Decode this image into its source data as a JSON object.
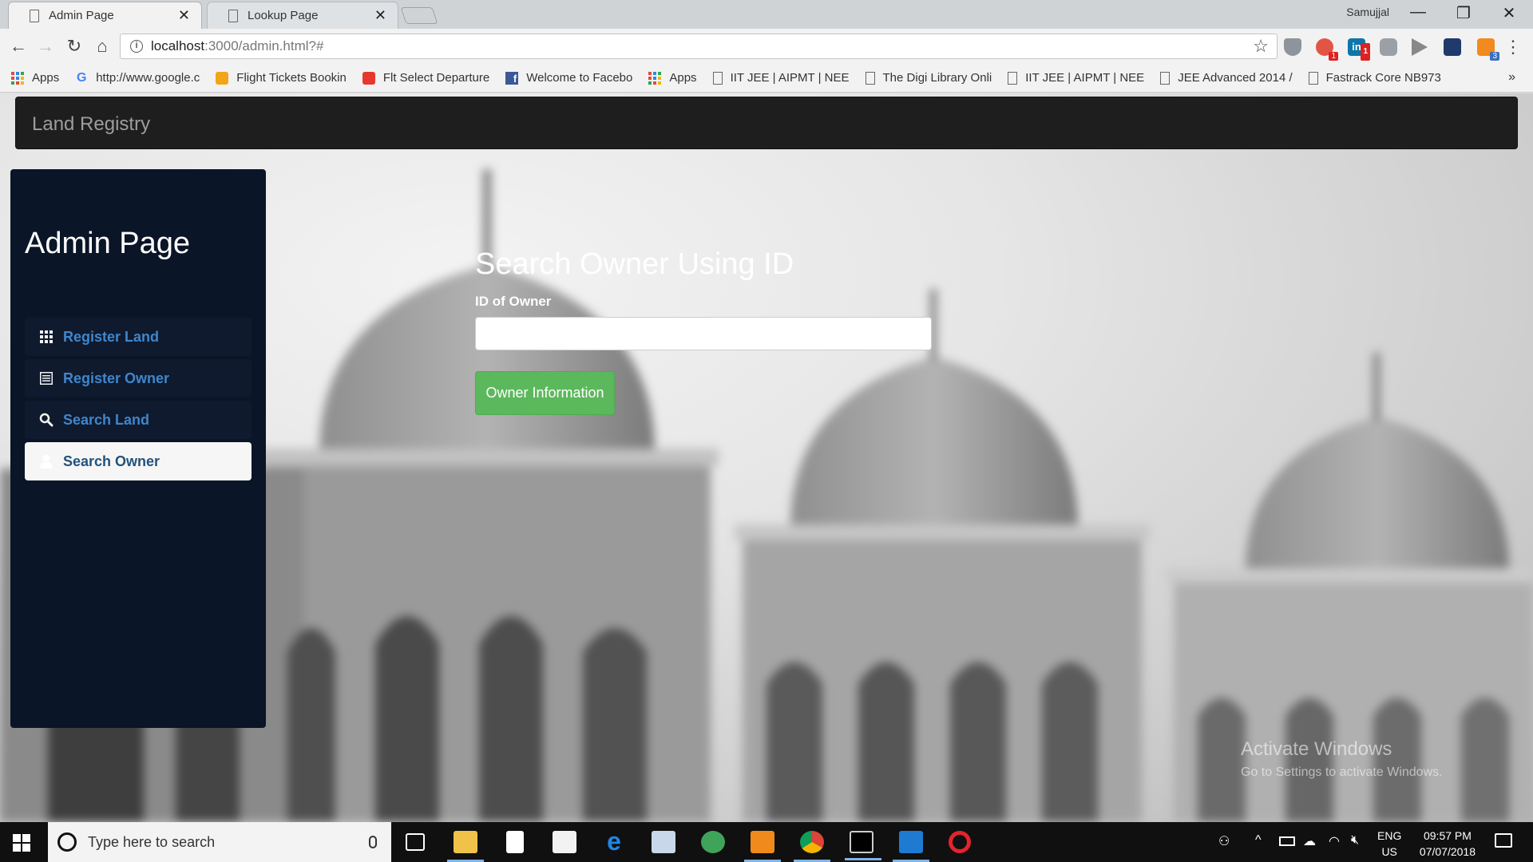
{
  "browser": {
    "tabs": [
      {
        "title": "Admin Page",
        "close": "✕"
      },
      {
        "title": "Lookup Page",
        "close": "✕"
      }
    ],
    "profile": "Samujjal",
    "window_controls": {
      "minimize": "—",
      "restore": "❐",
      "close": "✕"
    },
    "nav": {
      "back": "←",
      "forward": "→",
      "reload": "↻",
      "home": "⌂"
    },
    "url_host": "localhost",
    "url_rest": ":3000/admin.html?#",
    "star": "☆",
    "menu": "⋮",
    "extension_badges": {
      "ext1": "1",
      "ext2": "1",
      "ext3": "3"
    },
    "bookmarks": [
      {
        "icon": "apps-icon",
        "label": "Apps"
      },
      {
        "icon": "google-icon",
        "label": "http://www.google.c"
      },
      {
        "icon": "flight-icon",
        "label": "Flight Tickets Bookin"
      },
      {
        "icon": "makemytrip-icon",
        "label": "Flt Select Departure"
      },
      {
        "icon": "facebook-icon",
        "label": "Welcome to Facebo"
      },
      {
        "icon": "apps-icon",
        "label": "Apps"
      },
      {
        "icon": "page-icon",
        "label": "IIT JEE | AIPMT | NEE"
      },
      {
        "icon": "page-icon",
        "label": "The Digi Library Onli"
      },
      {
        "icon": "page-icon",
        "label": "IIT JEE | AIPMT | NEE"
      },
      {
        "icon": "page-icon",
        "label": "JEE Advanced 2014 /"
      },
      {
        "icon": "page-icon",
        "label": "Fastrack Core NB973"
      }
    ],
    "bookmarks_more": "»"
  },
  "page": {
    "brand": "Land Registry",
    "sidebar": {
      "title": "Admin Page",
      "items": [
        {
          "label": "Register Land",
          "icon": "grid-icon",
          "active": false
        },
        {
          "label": "Register Owner",
          "icon": "list-icon",
          "active": false
        },
        {
          "label": "Search Land",
          "icon": "search-icon",
          "active": false
        },
        {
          "label": "Search Owner",
          "icon": "user-icon",
          "active": true
        }
      ]
    },
    "main": {
      "title": "Search Owner Using ID",
      "field_label": "ID of Owner",
      "input_value": "",
      "input_placeholder": "",
      "button_label": "Owner Information"
    },
    "watermark": {
      "line1": "Activate Windows",
      "line2": "Go to Settings to activate Windows."
    }
  },
  "taskbar": {
    "search_placeholder": "Type here to search",
    "apps": [
      "task-view-icon",
      "file-explorer-icon",
      "notepad-icon",
      "store-icon",
      "edge-icon",
      "app-icon",
      "atom-icon",
      "sublime-icon",
      "chrome-icon",
      "terminal-icon",
      "vscode-icon",
      "opera-icon"
    ],
    "lang_line1": "ENG",
    "lang_line2": "US",
    "time": "09:57 PM",
    "date": "07/07/2018"
  },
  "colors": {
    "navbar_bg": "#1e1e1e",
    "sidebar_bg": "#0b1528",
    "link": "#3f86cc",
    "button_green": "#5cb85c"
  }
}
